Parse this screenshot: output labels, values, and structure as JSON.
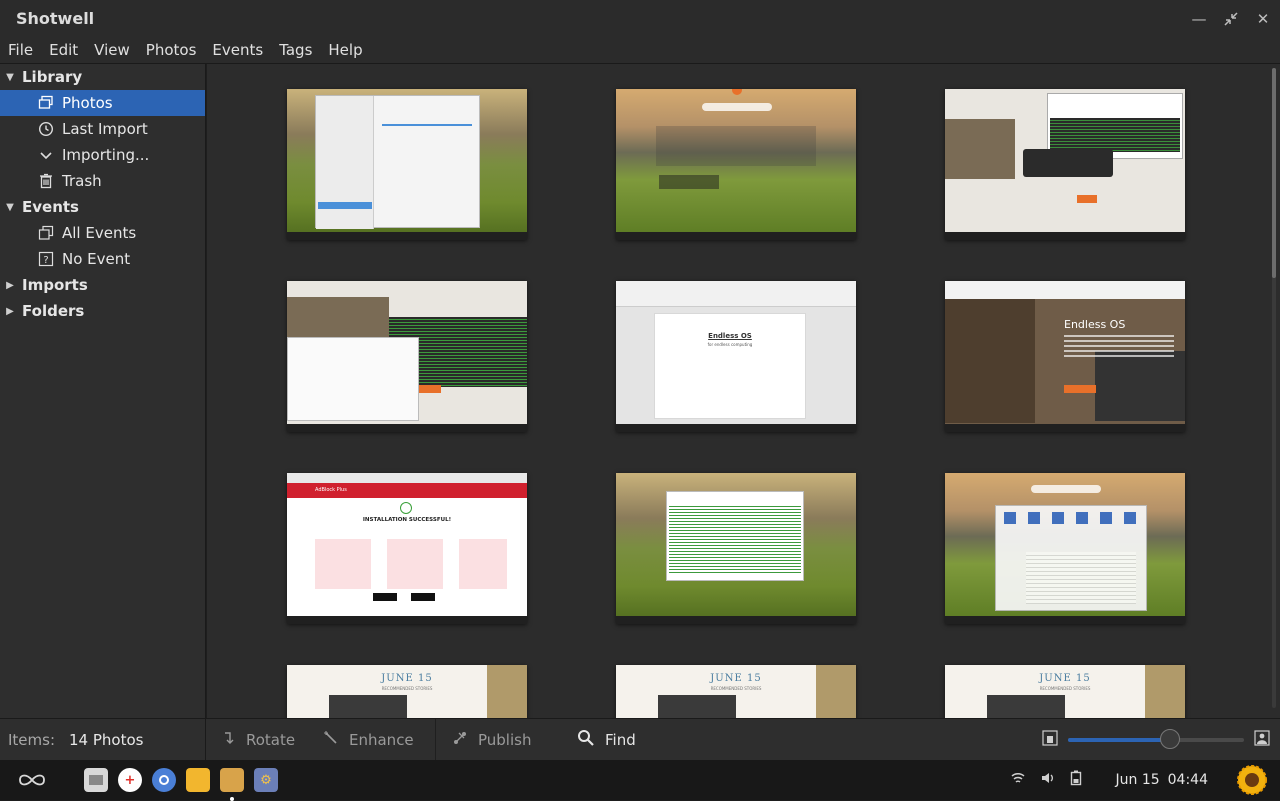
{
  "window": {
    "title": "Shotwell"
  },
  "menu": [
    "File",
    "Edit",
    "View",
    "Photos",
    "Events",
    "Tags",
    "Help"
  ],
  "sidebar": {
    "library": "Library",
    "library_items": [
      {
        "label": "Photos",
        "icon": "photos-icon",
        "selected": true
      },
      {
        "label": "Last Import",
        "icon": "clock-icon"
      },
      {
        "label": "Importing...",
        "icon": "chevron-down-icon"
      },
      {
        "label": "Trash",
        "icon": "trash-icon"
      }
    ],
    "events": "Events",
    "event_items": [
      {
        "label": "All Events",
        "icon": "all-events-icon"
      },
      {
        "label": "No Event",
        "icon": "no-event-icon"
      }
    ],
    "imports": "Imports",
    "folders": "Folders"
  },
  "thumbnails": {
    "june_title": "JUNE 15",
    "june_subtitle": "RECOMMENDED STORIES",
    "endless_heading": "Endless OS",
    "endless_sub": "for endless computing",
    "install_heading": "INSTALLATION SUCCESSFUL!",
    "install_brand": "AdBlock Plus"
  },
  "status": {
    "items_label": "Items:",
    "items_value": "14 Photos",
    "rotate": "Rotate",
    "enhance": "Enhance",
    "publish": "Publish",
    "find": "Find",
    "zoom_level": 0.58
  },
  "taskbar": {
    "date": "Jun 15",
    "time": "04:44"
  },
  "colors": {
    "accent": "#2c64b4"
  }
}
